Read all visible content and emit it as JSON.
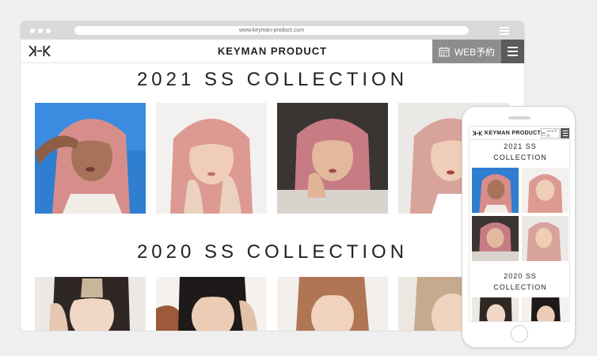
{
  "browser": {
    "url": "www.keyman-product.com"
  },
  "header": {
    "logo_text": "KK",
    "brand": "KEYMAN PRODUCT",
    "reserve_label": "WEB予約"
  },
  "sections": [
    {
      "title": "2021 SS COLLECTION"
    },
    {
      "title": "2020 SS COLLECTION"
    }
  ],
  "mobile": {
    "brand": "KEYMAN PRODUCT",
    "reserve_label": "WEB予約",
    "sections": [
      {
        "title_line1": "2021 SS",
        "title_line2": "COLLECTION"
      },
      {
        "title_line1": "2020 SS",
        "title_line2": "COLLECTION"
      }
    ]
  },
  "colors": {
    "reserve_bg": "#8d8d8d",
    "menu_bg": "#5a5a5a",
    "hair_pink": "#d99a95",
    "sky_blue": "#2f7ed0"
  }
}
